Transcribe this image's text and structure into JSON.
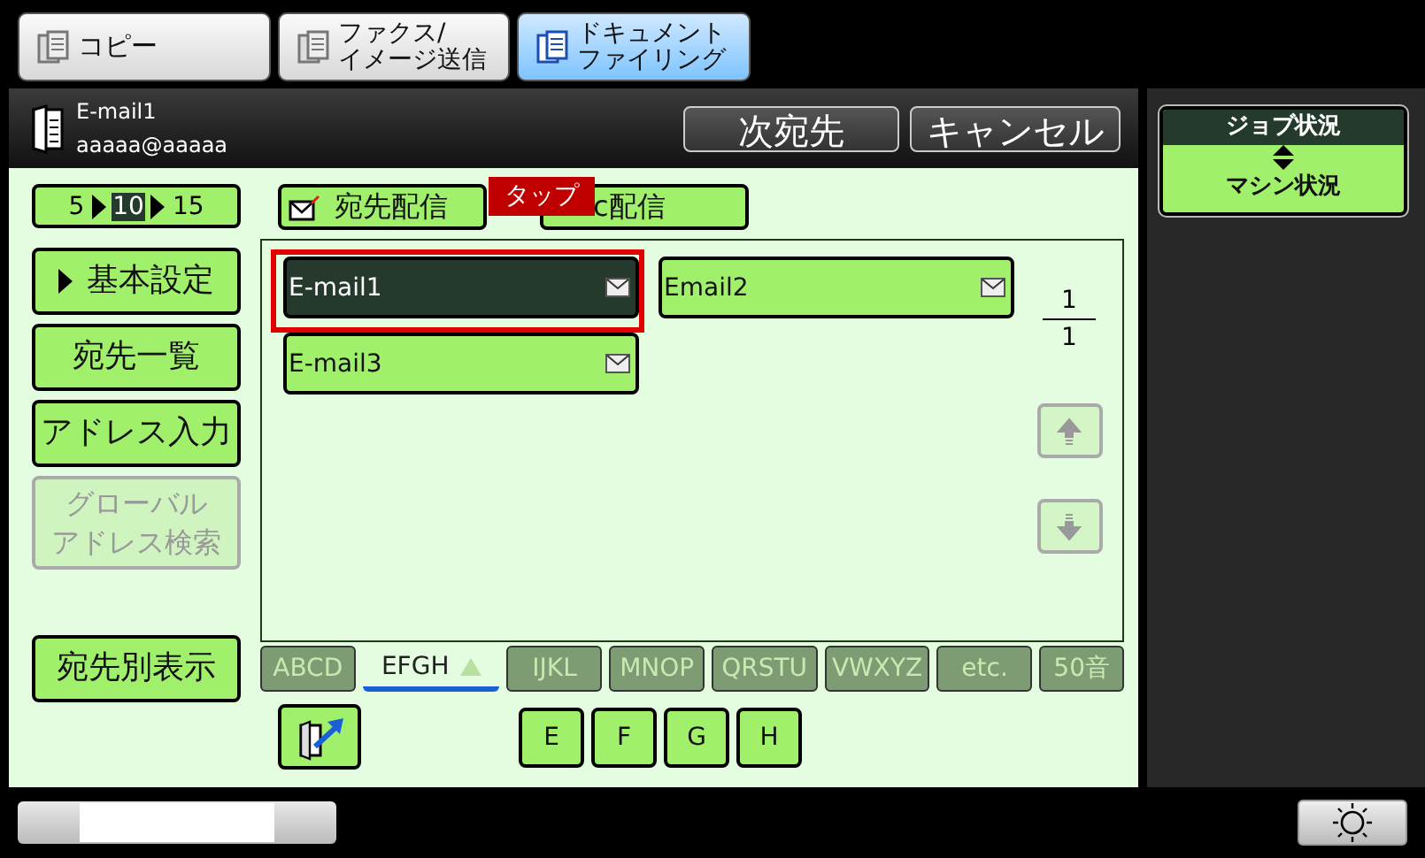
{
  "mode_tabs": [
    {
      "lines": [
        "コピー"
      ],
      "selected": false
    },
    {
      "lines": [
        "ファクス/",
        "イメージ送信"
      ],
      "selected": false
    },
    {
      "lines": [
        "ドキュメント",
        "ファイリング"
      ],
      "selected": true
    }
  ],
  "header": {
    "title": "E-mail1",
    "address": "aaaaa@aaaaa",
    "buttons": [
      "次宛先",
      "キャンセル"
    ]
  },
  "status_button": {
    "top": "ジョブ状況",
    "bottom": "マシン状況"
  },
  "display_count": [
    {
      "label": "5",
      "selected": false
    },
    {
      "label": "10",
      "selected": true
    },
    {
      "label": "15",
      "selected": false
    }
  ],
  "side_buttons": [
    {
      "lines": [
        "基本設定"
      ],
      "kind": "expander",
      "disabled": false
    },
    {
      "lines": [
        "宛先一覧"
      ],
      "kind": "plain",
      "disabled": false
    },
    {
      "lines": [
        "アドレス入力"
      ],
      "kind": "plain",
      "disabled": false
    },
    {
      "lines": [
        "グローバル",
        "アドレス検索"
      ],
      "kind": "plain",
      "disabled": true
    }
  ],
  "view_button": "宛先別表示",
  "send_tabs": [
    {
      "label": "宛先配信",
      "kind": "envelope"
    },
    {
      "label": "c配信",
      "kind": "plain"
    }
  ],
  "entries": [
    {
      "label": "E-mail1",
      "selected": true
    },
    {
      "label": "Email2",
      "selected": false
    },
    {
      "label": "E-mail3",
      "selected": false
    }
  ],
  "page": {
    "current": "1",
    "total": "1"
  },
  "scroll_buttons": [
    {
      "kind": "up",
      "disabled": true
    },
    {
      "kind": "down",
      "disabled": true
    }
  ],
  "index_tabs": [
    {
      "label": "ABCD",
      "selected": false
    },
    {
      "label": "EFGH",
      "selected": true
    },
    {
      "label": "IJKL",
      "selected": false
    },
    {
      "label": "MNOP",
      "selected": false
    },
    {
      "label": "QRSTU",
      "selected": false
    },
    {
      "label": "VWXYZ",
      "selected": false
    },
    {
      "label": "etc.",
      "selected": false
    },
    {
      "label": "50音",
      "selected": false
    }
  ],
  "letter_keys": [
    "E",
    "F",
    "G",
    "H"
  ],
  "callout": {
    "label": "タップ"
  }
}
